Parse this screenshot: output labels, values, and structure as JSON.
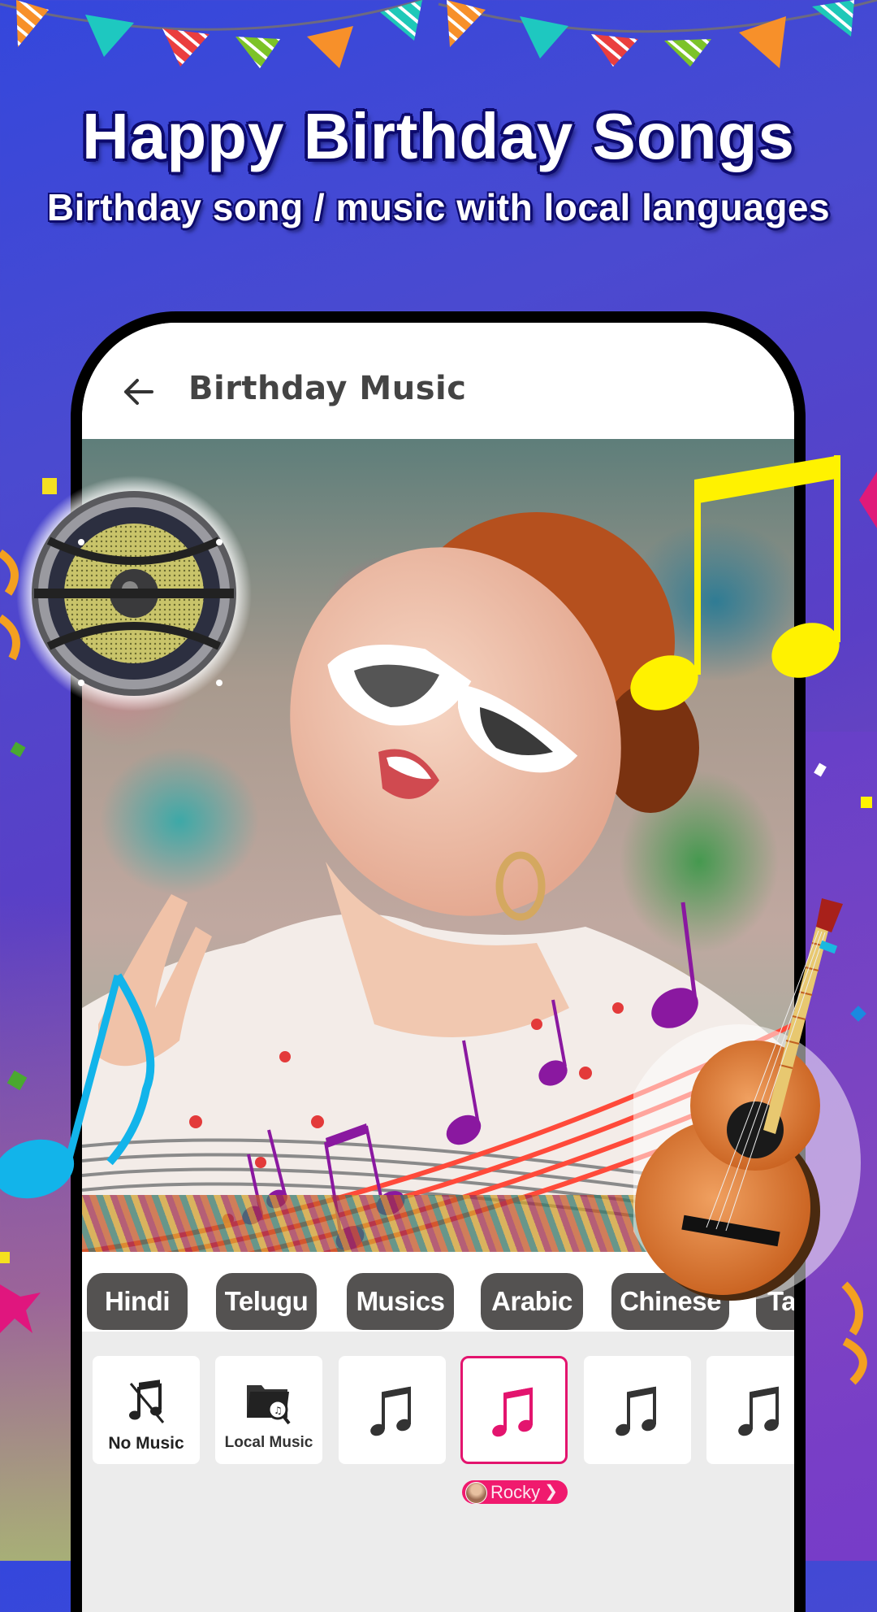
{
  "promo": {
    "title": "Happy Birthday Songs",
    "subtitle": "Birthday song / music with local languages"
  },
  "app": {
    "back_icon": "arrow-left-icon",
    "title": "Birthday Music"
  },
  "categories": [
    {
      "label": "Hindi"
    },
    {
      "label": "Telugu"
    },
    {
      "label": "Musics"
    },
    {
      "label": "Arabic"
    },
    {
      "label": "Chinese"
    },
    {
      "label": "Ta"
    }
  ],
  "music_options": [
    {
      "label": "No Music",
      "icon": "music-off-icon",
      "selected": false
    },
    {
      "label": "Local Music",
      "icon": "folder-music-search-icon",
      "selected": false
    },
    {
      "label": "",
      "icon": "music-note-icon",
      "selected": false
    },
    {
      "label": "",
      "icon": "music-note-icon",
      "selected": true
    },
    {
      "label": "",
      "icon": "music-note-icon",
      "selected": false
    },
    {
      "label": "",
      "icon": "music-note-icon",
      "selected": false
    }
  ],
  "selected_track": {
    "artist": "Rocky",
    "chevron": "chevron-right-icon"
  },
  "colors": {
    "accent": "#e3146e",
    "chip_bg": "#545251",
    "title_outline": "#0d0a6e"
  }
}
